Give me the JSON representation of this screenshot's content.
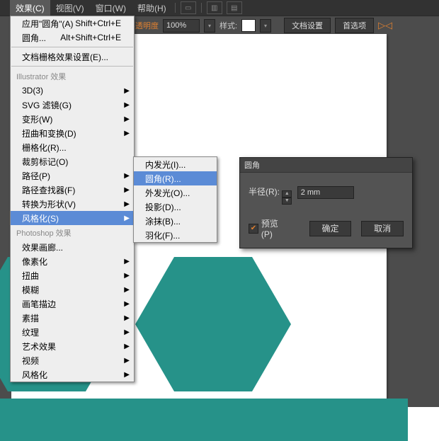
{
  "menubar": {
    "items": [
      "效果(C)",
      "视图(V)",
      "窗口(W)",
      "帮助(H)"
    ]
  },
  "toolbar": {
    "opacity_label": "不透明度",
    "opacity_value": "100%",
    "style_label": "样式:",
    "doc_setup": "文档设置",
    "prefs": "首选项",
    "orange_glyph": "▷◁"
  },
  "effects_menu": {
    "apply": {
      "label": "应用\"圆角\"(A)",
      "shortcut": "Shift+Ctrl+E"
    },
    "reapply": {
      "label": "圆角...",
      "shortcut": "Alt+Shift+Ctrl+E"
    },
    "raster_settings": "文档栅格效果设置(E)...",
    "illustrator_header": "Illustrator 效果",
    "il_items": [
      {
        "label": "3D(3)",
        "sub": true
      },
      {
        "label": "SVG 滤镜(G)",
        "sub": true
      },
      {
        "label": "变形(W)",
        "sub": true
      },
      {
        "label": "扭曲和变换(D)",
        "sub": true
      },
      {
        "label": "栅格化(R)...",
        "sub": false
      },
      {
        "label": "裁剪标记(O)",
        "sub": false
      },
      {
        "label": "路径(P)",
        "sub": true
      },
      {
        "label": "路径查找器(F)",
        "sub": true
      },
      {
        "label": "转换为形状(V)",
        "sub": true
      },
      {
        "label": "风格化(S)",
        "sub": true,
        "hl": true
      }
    ],
    "photoshop_header": "Photoshop 效果",
    "ps_items": [
      {
        "label": "效果画廊...",
        "sub": false
      },
      {
        "label": "像素化",
        "sub": true
      },
      {
        "label": "扭曲",
        "sub": true
      },
      {
        "label": "模糊",
        "sub": true
      },
      {
        "label": "画笔描边",
        "sub": true
      },
      {
        "label": "素描",
        "sub": true
      },
      {
        "label": "纹理",
        "sub": true
      },
      {
        "label": "艺术效果",
        "sub": true
      },
      {
        "label": "视频",
        "sub": true
      },
      {
        "label": "风格化",
        "sub": true
      }
    ]
  },
  "stylize_submenu": [
    {
      "label": "内发光(I)..."
    },
    {
      "label": "圆角(R)...",
      "hl": true
    },
    {
      "label": "外发光(O)..."
    },
    {
      "label": "投影(D)..."
    },
    {
      "label": "涂抹(B)..."
    },
    {
      "label": "羽化(F)..."
    }
  ],
  "dialog": {
    "title": "圆角",
    "radius_label": "半径(R):",
    "radius_value": "2 mm",
    "preview_label": "预览(P)",
    "ok": "确定",
    "cancel": "取消"
  }
}
